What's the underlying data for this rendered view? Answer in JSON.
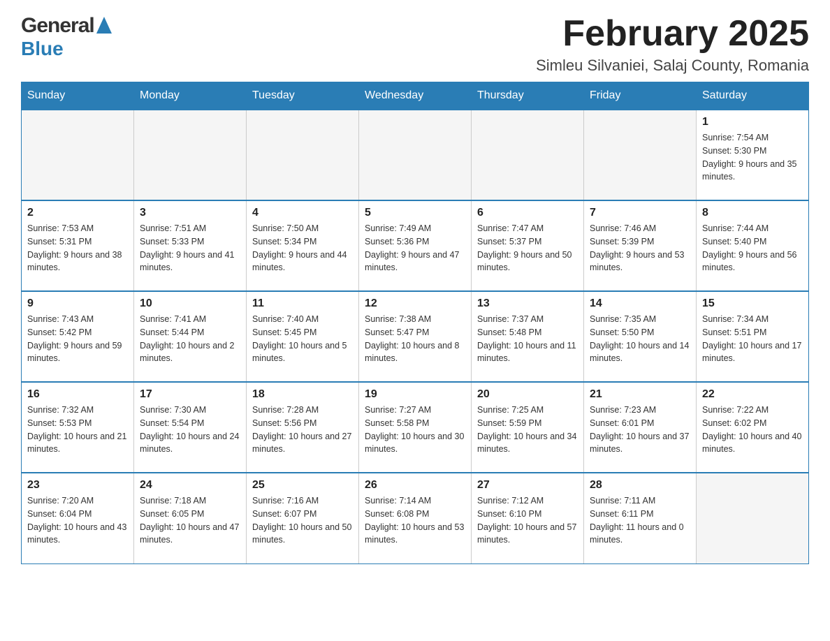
{
  "header": {
    "logo": {
      "part1": "General",
      "part2": "Blue"
    },
    "title": "February 2025",
    "subtitle": "Simleu Silvaniei, Salaj County, Romania"
  },
  "days_of_week": [
    "Sunday",
    "Monday",
    "Tuesday",
    "Wednesday",
    "Thursday",
    "Friday",
    "Saturday"
  ],
  "weeks": [
    [
      {
        "day": "",
        "info": ""
      },
      {
        "day": "",
        "info": ""
      },
      {
        "day": "",
        "info": ""
      },
      {
        "day": "",
        "info": ""
      },
      {
        "day": "",
        "info": ""
      },
      {
        "day": "",
        "info": ""
      },
      {
        "day": "1",
        "info": "Sunrise: 7:54 AM\nSunset: 5:30 PM\nDaylight: 9 hours and 35 minutes."
      }
    ],
    [
      {
        "day": "2",
        "info": "Sunrise: 7:53 AM\nSunset: 5:31 PM\nDaylight: 9 hours and 38 minutes."
      },
      {
        "day": "3",
        "info": "Sunrise: 7:51 AM\nSunset: 5:33 PM\nDaylight: 9 hours and 41 minutes."
      },
      {
        "day": "4",
        "info": "Sunrise: 7:50 AM\nSunset: 5:34 PM\nDaylight: 9 hours and 44 minutes."
      },
      {
        "day": "5",
        "info": "Sunrise: 7:49 AM\nSunset: 5:36 PM\nDaylight: 9 hours and 47 minutes."
      },
      {
        "day": "6",
        "info": "Sunrise: 7:47 AM\nSunset: 5:37 PM\nDaylight: 9 hours and 50 minutes."
      },
      {
        "day": "7",
        "info": "Sunrise: 7:46 AM\nSunset: 5:39 PM\nDaylight: 9 hours and 53 minutes."
      },
      {
        "day": "8",
        "info": "Sunrise: 7:44 AM\nSunset: 5:40 PM\nDaylight: 9 hours and 56 minutes."
      }
    ],
    [
      {
        "day": "9",
        "info": "Sunrise: 7:43 AM\nSunset: 5:42 PM\nDaylight: 9 hours and 59 minutes."
      },
      {
        "day": "10",
        "info": "Sunrise: 7:41 AM\nSunset: 5:44 PM\nDaylight: 10 hours and 2 minutes."
      },
      {
        "day": "11",
        "info": "Sunrise: 7:40 AM\nSunset: 5:45 PM\nDaylight: 10 hours and 5 minutes."
      },
      {
        "day": "12",
        "info": "Sunrise: 7:38 AM\nSunset: 5:47 PM\nDaylight: 10 hours and 8 minutes."
      },
      {
        "day": "13",
        "info": "Sunrise: 7:37 AM\nSunset: 5:48 PM\nDaylight: 10 hours and 11 minutes."
      },
      {
        "day": "14",
        "info": "Sunrise: 7:35 AM\nSunset: 5:50 PM\nDaylight: 10 hours and 14 minutes."
      },
      {
        "day": "15",
        "info": "Sunrise: 7:34 AM\nSunset: 5:51 PM\nDaylight: 10 hours and 17 minutes."
      }
    ],
    [
      {
        "day": "16",
        "info": "Sunrise: 7:32 AM\nSunset: 5:53 PM\nDaylight: 10 hours and 21 minutes."
      },
      {
        "day": "17",
        "info": "Sunrise: 7:30 AM\nSunset: 5:54 PM\nDaylight: 10 hours and 24 minutes."
      },
      {
        "day": "18",
        "info": "Sunrise: 7:28 AM\nSunset: 5:56 PM\nDaylight: 10 hours and 27 minutes."
      },
      {
        "day": "19",
        "info": "Sunrise: 7:27 AM\nSunset: 5:58 PM\nDaylight: 10 hours and 30 minutes."
      },
      {
        "day": "20",
        "info": "Sunrise: 7:25 AM\nSunset: 5:59 PM\nDaylight: 10 hours and 34 minutes."
      },
      {
        "day": "21",
        "info": "Sunrise: 7:23 AM\nSunset: 6:01 PM\nDaylight: 10 hours and 37 minutes."
      },
      {
        "day": "22",
        "info": "Sunrise: 7:22 AM\nSunset: 6:02 PM\nDaylight: 10 hours and 40 minutes."
      }
    ],
    [
      {
        "day": "23",
        "info": "Sunrise: 7:20 AM\nSunset: 6:04 PM\nDaylight: 10 hours and 43 minutes."
      },
      {
        "day": "24",
        "info": "Sunrise: 7:18 AM\nSunset: 6:05 PM\nDaylight: 10 hours and 47 minutes."
      },
      {
        "day": "25",
        "info": "Sunrise: 7:16 AM\nSunset: 6:07 PM\nDaylight: 10 hours and 50 minutes."
      },
      {
        "day": "26",
        "info": "Sunrise: 7:14 AM\nSunset: 6:08 PM\nDaylight: 10 hours and 53 minutes."
      },
      {
        "day": "27",
        "info": "Sunrise: 7:12 AM\nSunset: 6:10 PM\nDaylight: 10 hours and 57 minutes."
      },
      {
        "day": "28",
        "info": "Sunrise: 7:11 AM\nSunset: 6:11 PM\nDaylight: 11 hours and 0 minutes."
      },
      {
        "day": "",
        "info": ""
      }
    ]
  ]
}
